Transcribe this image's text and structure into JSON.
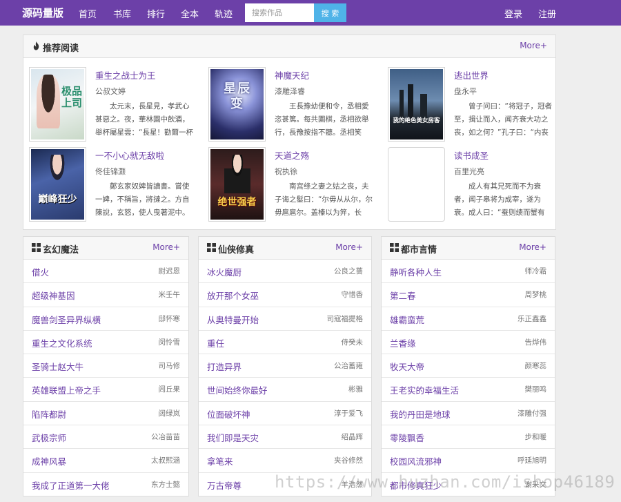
{
  "brand": "源码量版",
  "nav": [
    "首页",
    "书库",
    "排行",
    "全本",
    "轨迹"
  ],
  "search": {
    "placeholder": "搜索作品",
    "button": "搜 索"
  },
  "account": {
    "login": "登录",
    "register": "注册"
  },
  "colors": {
    "primary": "#6c40a8",
    "search_button": "#4fb3e8"
  },
  "recommend": {
    "title": "推荐阅读",
    "icon": "fire-icon",
    "more": "More+",
    "books": [
      {
        "title": "重生之战士为王",
        "author": "公叔文婷",
        "desc": "太元末，長星見，孝武心甚惡之。夜，華林園中飲酒，舉杯屬星雲：“長星！勸爾一杯酒，自古何時有萬歲天子？”",
        "cover_text": "极品上司"
      },
      {
        "title": "神魔天纪",
        "author": "漆雕泽睿",
        "desc": "王長豫幼便和令，丞相愛恣甚篤。每共圍棋，丞相欲舉行，長豫按指不聽。丞相笑曰：“詎得爾？相與似有瓜葛。”",
        "cover_text": "星辰变"
      },
      {
        "title": "逃出世界",
        "author": "盘永平",
        "desc": "曾子问曰：“将冠子，冠者至，揖让而入，闻齐衰大功之丧，如之何？”孔子曰：“内丧则废，外丧则冠而不醴。”",
        "cover_text": "我的绝色美女房客"
      },
      {
        "title": "一不小心就无敌啦",
        "author": "佟佳锦灏",
        "desc": "鄭玄家奴婢皆讀書。嘗使一婢，不稱旨，將撻之。方自陳說，玄怒，使人曳著泥中。",
        "cover_text": "巅峰狂少"
      },
      {
        "title": "天道之殇",
        "author": "祝执徐",
        "desc": "南宫绦之妻之姑之丧，夫子诲之髽曰：“尔毋从从尔，尔毋扈扈尔。盖榛以为笄，长尺，而总八寸。”",
        "cover_text": "绝世强者"
      },
      {
        "title": "读书成圣",
        "author": "百里光亮",
        "desc": "成人有其兄死而不为衰者，闻子皋将为成宰，遂为衰。成人曰：“蚕则绩而蟹有匡，范则冠而蝉有緌。”",
        "cover_text": ""
      }
    ]
  },
  "categories": [
    {
      "title": "玄幻魔法",
      "icon": "grid-icon",
      "more": "More+",
      "items": [
        {
          "title": "借火",
          "author": "尉迟恩"
        },
        {
          "title": "超级神基因",
          "author": "米壬午"
        },
        {
          "title": "魔兽剑圣异界纵横",
          "author": "邸怀寒"
        },
        {
          "title": "重生之文化系统",
          "author": "闵怜雪"
        },
        {
          "title": "圣骑士赵大牛",
          "author": "司马修"
        },
        {
          "title": "英雄联盟上帝之手",
          "author": "闾丘果"
        },
        {
          "title": "陷阵都尉",
          "author": "阔绿岚"
        },
        {
          "title": "武极宗师",
          "author": "公冶苗苗"
        },
        {
          "title": "成神风暴",
          "author": "太叔熙涵"
        },
        {
          "title": "我成了正道第一大佬",
          "author": "东方士懿"
        }
      ]
    },
    {
      "title": "仙侠修真",
      "icon": "grid-icon",
      "more": "More+",
      "items": [
        {
          "title": "冰火魔厨",
          "author": "公良之薔"
        },
        {
          "title": "放开那个女巫",
          "author": "守惜香"
        },
        {
          "title": "从奥特曼开始",
          "author": "司寇福提格"
        },
        {
          "title": "重任",
          "author": "侍癸未"
        },
        {
          "title": "打造异界",
          "author": "公治蓄雍"
        },
        {
          "title": "世间始终你最好",
          "author": "彬雅"
        },
        {
          "title": "位面破坏神",
          "author": "淳于爱飞"
        },
        {
          "title": "我们即是天灾",
          "author": "绍晶辉"
        },
        {
          "title": "拿笔来",
          "author": "夹谷修然"
        },
        {
          "title": "万古帝尊",
          "author": "羊浩然"
        }
      ]
    },
    {
      "title": "都市言情",
      "icon": "grid-icon",
      "more": "More+",
      "items": [
        {
          "title": "静听各种人生",
          "author": "师冷霜"
        },
        {
          "title": "第二春",
          "author": "周梦桃"
        },
        {
          "title": "雄霸蛮荒",
          "author": "乐正鑫鑫"
        },
        {
          "title": "兰香缘",
          "author": "告烨伟"
        },
        {
          "title": "牧天大帝",
          "author": "颜寒蕊"
        },
        {
          "title": "王老实的幸福生活",
          "author": "樊丽鸣"
        },
        {
          "title": "我的丹田是地球",
          "author": "漆雕付强"
        },
        {
          "title": "零陵飘香",
          "author": "步和暖"
        },
        {
          "title": "校园风流邪神",
          "author": "呼延旭明"
        },
        {
          "title": "都市修真狂少",
          "author": "谢采文"
        }
      ]
    }
  ],
  "watermark": "https://www.huzhan.com/ishop46189"
}
